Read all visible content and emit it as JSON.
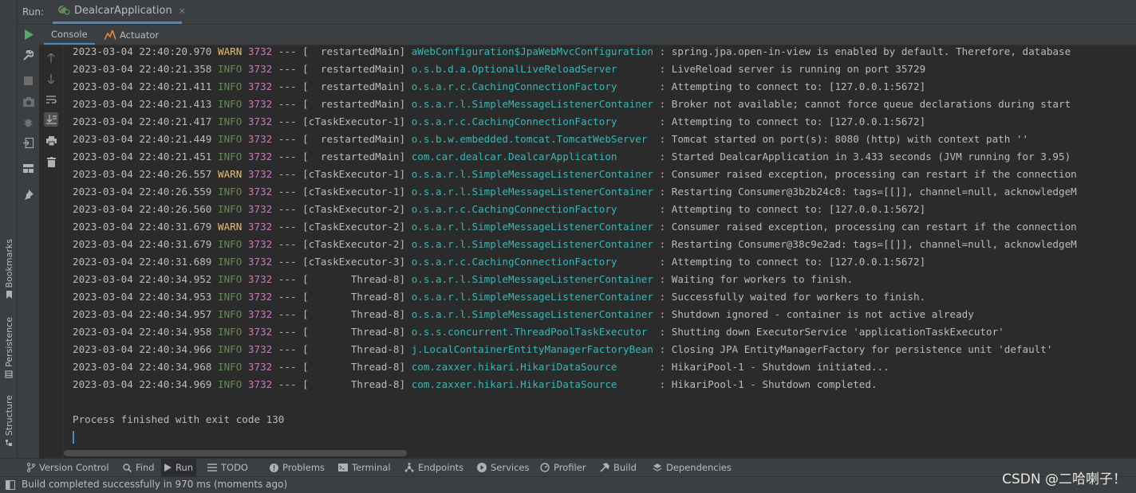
{
  "run_bar": {
    "label": "Run:",
    "tab_title": "DealcarApplication",
    "tab_close": "×"
  },
  "sub_tabs": {
    "console": "Console",
    "actuator": "Actuator"
  },
  "left_strip": {
    "bookmarks": "Bookmarks",
    "persistence": "Persistence",
    "structure": "Structure"
  },
  "log": [
    {
      "ts": "2023-03-04 22:40:20.970",
      "level": "WARN",
      "pid": "3732",
      "sep": " --- [",
      "thread": "  restartedMain]",
      "logger": "aWebConfiguration$JpaWebMvcConfiguration",
      "msg": " : spring.jpa.open-in-view is enabled by default. Therefore, database"
    },
    {
      "ts": "2023-03-04 22:40:21.358",
      "level": "INFO",
      "pid": "3732",
      "sep": " --- [",
      "thread": "  restartedMain]",
      "logger": "o.s.b.d.a.OptionalLiveReloadServer      ",
      "msg": " : LiveReload server is running on port 35729"
    },
    {
      "ts": "2023-03-04 22:40:21.411",
      "level": "INFO",
      "pid": "3732",
      "sep": " --- [",
      "thread": "  restartedMain]",
      "logger": "o.s.a.r.c.CachingConnectionFactory      ",
      "msg": " : Attempting to connect to: [127.0.0.1:5672]"
    },
    {
      "ts": "2023-03-04 22:40:21.413",
      "level": "INFO",
      "pid": "3732",
      "sep": " --- [",
      "thread": "  restartedMain]",
      "logger": "o.s.a.r.l.SimpleMessageListenerContainer",
      "msg": " : Broker not available; cannot force queue declarations during start"
    },
    {
      "ts": "2023-03-04 22:40:21.417",
      "level": "INFO",
      "pid": "3732",
      "sep": " --- [",
      "thread": "cTaskExecutor-1]",
      "logger": "o.s.a.r.c.CachingConnectionFactory      ",
      "msg": " : Attempting to connect to: [127.0.0.1:5672]"
    },
    {
      "ts": "2023-03-04 22:40:21.449",
      "level": "INFO",
      "pid": "3732",
      "sep": " --- [",
      "thread": "  restartedMain]",
      "logger": "o.s.b.w.embedded.tomcat.TomcatWebServer ",
      "msg": " : Tomcat started on port(s): 8080 (http) with context path ''"
    },
    {
      "ts": "2023-03-04 22:40:21.451",
      "level": "INFO",
      "pid": "3732",
      "sep": " --- [",
      "thread": "  restartedMain]",
      "logger": "com.car.dealcar.DealcarApplication      ",
      "msg": " : Started DealcarApplication in 3.433 seconds (JVM running for 3.95)"
    },
    {
      "ts": "2023-03-04 22:40:26.557",
      "level": "WARN",
      "pid": "3732",
      "sep": " --- [",
      "thread": "cTaskExecutor-1]",
      "logger": "o.s.a.r.l.SimpleMessageListenerContainer",
      "msg": " : Consumer raised exception, processing can restart if the connection"
    },
    {
      "ts": "2023-03-04 22:40:26.559",
      "level": "INFO",
      "pid": "3732",
      "sep": " --- [",
      "thread": "cTaskExecutor-1]",
      "logger": "o.s.a.r.l.SimpleMessageListenerContainer",
      "msg": " : Restarting Consumer@3b2b24c8: tags=[[]], channel=null, acknowledgeM"
    },
    {
      "ts": "2023-03-04 22:40:26.560",
      "level": "INFO",
      "pid": "3732",
      "sep": " --- [",
      "thread": "cTaskExecutor-2]",
      "logger": "o.s.a.r.c.CachingConnectionFactory      ",
      "msg": " : Attempting to connect to: [127.0.0.1:5672]"
    },
    {
      "ts": "2023-03-04 22:40:31.679",
      "level": "WARN",
      "pid": "3732",
      "sep": " --- [",
      "thread": "cTaskExecutor-2]",
      "logger": "o.s.a.r.l.SimpleMessageListenerContainer",
      "msg": " : Consumer raised exception, processing can restart if the connection"
    },
    {
      "ts": "2023-03-04 22:40:31.679",
      "level": "INFO",
      "pid": "3732",
      "sep": " --- [",
      "thread": "cTaskExecutor-2]",
      "logger": "o.s.a.r.l.SimpleMessageListenerContainer",
      "msg": " : Restarting Consumer@38c9e2ad: tags=[[]], channel=null, acknowledgeM"
    },
    {
      "ts": "2023-03-04 22:40:31.689",
      "level": "INFO",
      "pid": "3732",
      "sep": " --- [",
      "thread": "cTaskExecutor-3]",
      "logger": "o.s.a.r.c.CachingConnectionFactory      ",
      "msg": " : Attempting to connect to: [127.0.0.1:5672]"
    },
    {
      "ts": "2023-03-04 22:40:34.952",
      "level": "INFO",
      "pid": "3732",
      "sep": " --- [",
      "thread": "       Thread-8]",
      "logger": "o.s.a.r.l.SimpleMessageListenerContainer",
      "msg": " : Waiting for workers to finish."
    },
    {
      "ts": "2023-03-04 22:40:34.953",
      "level": "INFO",
      "pid": "3732",
      "sep": " --- [",
      "thread": "       Thread-8]",
      "logger": "o.s.a.r.l.SimpleMessageListenerContainer",
      "msg": " : Successfully waited for workers to finish."
    },
    {
      "ts": "2023-03-04 22:40:34.957",
      "level": "INFO",
      "pid": "3732",
      "sep": " --- [",
      "thread": "       Thread-8]",
      "logger": "o.s.a.r.l.SimpleMessageListenerContainer",
      "msg": " : Shutdown ignored - container is not active already"
    },
    {
      "ts": "2023-03-04 22:40:34.958",
      "level": "INFO",
      "pid": "3732",
      "sep": " --- [",
      "thread": "       Thread-8]",
      "logger": "o.s.s.concurrent.ThreadPoolTaskExecutor ",
      "msg": " : Shutting down ExecutorService 'applicationTaskExecutor'"
    },
    {
      "ts": "2023-03-04 22:40:34.966",
      "level": "INFO",
      "pid": "3732",
      "sep": " --- [",
      "thread": "       Thread-8]",
      "logger": "j.LocalContainerEntityManagerFactoryBean",
      "msg": " : Closing JPA EntityManagerFactory for persistence unit 'default'"
    },
    {
      "ts": "2023-03-04 22:40:34.968",
      "level": "INFO",
      "pid": "3732",
      "sep": " --- [",
      "thread": "       Thread-8]",
      "logger": "com.zaxxer.hikari.HikariDataSource      ",
      "msg": " : HikariPool-1 - Shutdown initiated..."
    },
    {
      "ts": "2023-03-04 22:40:34.969",
      "level": "INFO",
      "pid": "3732",
      "sep": " --- [",
      "thread": "       Thread-8]",
      "logger": "com.zaxxer.hikari.HikariDataSource      ",
      "msg": " : HikariPool-1 - Shutdown completed."
    }
  ],
  "exit_message": "Process finished with exit code 130",
  "bottom_bar": [
    {
      "name": "version-control",
      "label": "Version Control",
      "icon": "branch-icon"
    },
    {
      "name": "find",
      "label": "Find",
      "icon": "search-icon"
    },
    {
      "name": "run",
      "label": "Run",
      "icon": "play-icon",
      "active": true
    },
    {
      "name": "todo",
      "label": "TODO",
      "icon": "list-icon"
    },
    {
      "name": "problems",
      "label": "Problems",
      "icon": "info-icon"
    },
    {
      "name": "terminal",
      "label": "Terminal",
      "icon": "terminal-icon"
    },
    {
      "name": "endpoints",
      "label": "Endpoints",
      "icon": "endpoints-icon"
    },
    {
      "name": "services",
      "label": "Services",
      "icon": "services-icon"
    },
    {
      "name": "profiler",
      "label": "Profiler",
      "icon": "profiler-icon"
    },
    {
      "name": "build",
      "label": "Build",
      "icon": "hammer-icon"
    },
    {
      "name": "dependencies",
      "label": "Dependencies",
      "icon": "layers-icon"
    }
  ],
  "status": {
    "text": "Build completed successfully in 970 ms (moments ago)",
    "watermark": "CSDN @二哈喇子！"
  },
  "colors": {
    "accent": "#4a88c7",
    "info": "#6a8759",
    "warn": "#e8bf6a",
    "pid": "#c77dbb",
    "logger": "#3fb4b4",
    "run_green": "#59a869"
  }
}
